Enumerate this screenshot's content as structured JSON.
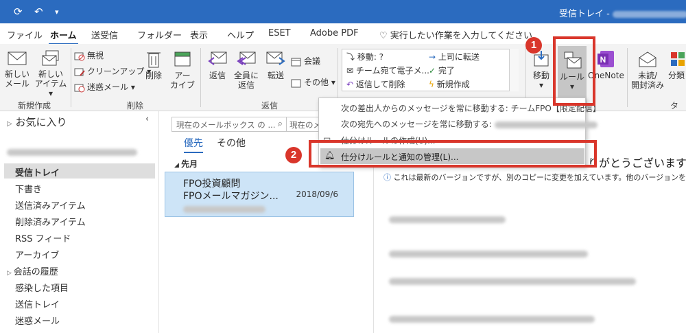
{
  "title_bar": {
    "title": "受信トレイ -"
  },
  "tabs": [
    "ファイル",
    "ホーム",
    "送受信",
    "フォルダー",
    "表示",
    "ヘルプ",
    "ESET",
    "Adobe PDF",
    "実行したい作業を入力してください"
  ],
  "ribbon": {
    "new_mail": "新しい\nメール",
    "new_items": "新しい\nアイテム",
    "ignore": "無視",
    "cleanup": "クリーンアップ",
    "junk": "迷惑メール",
    "delete": "削除",
    "archive": "アー\nカイブ",
    "reply": "返信",
    "reply_all": "全員に\n返信",
    "forward": "転送",
    "meeting": "会議",
    "more": "その他",
    "quick_steps": {
      "move": "移動: ?",
      "team": "チーム宛て電子メ...",
      "reply_delete": "返信して削除",
      "to_manager": "上司に転送",
      "done": "完了",
      "create_new": "新規作成"
    },
    "move_btn": "移動",
    "rules_btn": "ルール",
    "onenote": "OneNote",
    "unread_read": "未読/\n開封済み",
    "categorize": "分類",
    "groups": {
      "new": "新規作成",
      "delete": "削除",
      "respond": "返信",
      "tags": "タグ"
    }
  },
  "dropdown": {
    "item1": "次の差出人からのメッセージを常に移動する: チームFPO【限定配信】",
    "item2": "次の宛先へのメッセージを常に移動する:",
    "item3": "仕分けルールの作成(U)...",
    "item4": "仕分けルールと通知の管理(L)..."
  },
  "nav": {
    "favorites": "お気に入り",
    "folders": [
      "受信トレイ",
      "下書き",
      "送信済みアイテム",
      "削除済みアイテム",
      "RSS フィード",
      "アーカイブ",
      "会話の履歴",
      "感染した項目",
      "送信トレイ",
      "迷惑メール"
    ]
  },
  "list": {
    "search_placeholder": "現在のメールボックス の ...",
    "search_scope": "現在のメ",
    "filter_focused": "優先",
    "filter_other": "その他",
    "group_header": "先月",
    "mail": {
      "sender": "FPO投資顧問",
      "subject": "FPOメールマガジン...",
      "date": "2018/09/6"
    }
  },
  "reading": {
    "subject_tail": "りがとうございます！",
    "info": "これは最新のバージョンですが、別のコピーに変更を加えています。他のバージョンを表示する"
  },
  "badges": {
    "one": "1",
    "two": "2"
  }
}
